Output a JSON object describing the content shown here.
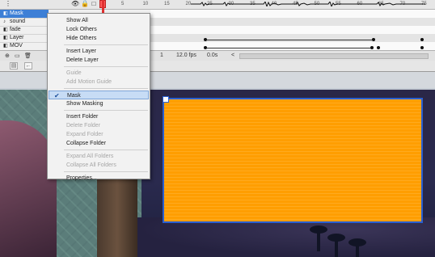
{
  "timeline": {
    "ruler_numbers": [
      "5",
      "10",
      "15",
      "20",
      "25",
      "30",
      "35",
      "40",
      "45",
      "50",
      "55",
      "60",
      "65",
      "70",
      "75"
    ],
    "layers": [
      {
        "name": "Mask",
        "selected": true
      },
      {
        "name": "sound",
        "selected": false
      },
      {
        "name": "fade",
        "selected": false
      },
      {
        "name": "Layer",
        "selected": false
      },
      {
        "name": "MOV",
        "selected": false
      }
    ],
    "footer": {
      "frame": "1",
      "fps": "12.0 fps",
      "time": "0.0s"
    }
  },
  "context_menu": {
    "items": [
      {
        "label": "Show All",
        "enabled": true,
        "checked": false,
        "highlighted": false
      },
      {
        "label": "Lock Others",
        "enabled": true,
        "checked": false,
        "highlighted": false
      },
      {
        "label": "Hide Others",
        "enabled": true,
        "checked": false,
        "highlighted": false
      },
      {
        "label": "Insert Layer",
        "enabled": true,
        "checked": false,
        "highlighted": false
      },
      {
        "label": "Delete Layer",
        "enabled": true,
        "checked": false,
        "highlighted": false
      },
      {
        "label": "Guide",
        "enabled": false,
        "checked": false,
        "highlighted": false
      },
      {
        "label": "Add Motion Guide",
        "enabled": false,
        "checked": false,
        "highlighted": false
      },
      {
        "label": "Mask",
        "enabled": true,
        "checked": true,
        "highlighted": true
      },
      {
        "label": "Show Masking",
        "enabled": true,
        "checked": false,
        "highlighted": false
      },
      {
        "label": "Insert Folder",
        "enabled": true,
        "checked": false,
        "highlighted": false
      },
      {
        "label": "Delete Folder",
        "enabled": false,
        "checked": false,
        "highlighted": false
      },
      {
        "label": "Expand Folder",
        "enabled": false,
        "checked": false,
        "highlighted": false
      },
      {
        "label": "Collapse Folder",
        "enabled": true,
        "checked": false,
        "highlighted": false
      },
      {
        "label": "Expand All Folders",
        "enabled": false,
        "checked": false,
        "highlighted": false
      },
      {
        "label": "Collapse All Folders",
        "enabled": false,
        "checked": false,
        "highlighted": false
      },
      {
        "label": "Properties...",
        "enabled": true,
        "checked": false,
        "highlighted": false
      }
    ]
  },
  "colors": {
    "selection": "#3d7fd6",
    "mask_fill": "#ff9e00",
    "playhead": "#e03030",
    "menu_highlight": "#c7dcf5"
  }
}
